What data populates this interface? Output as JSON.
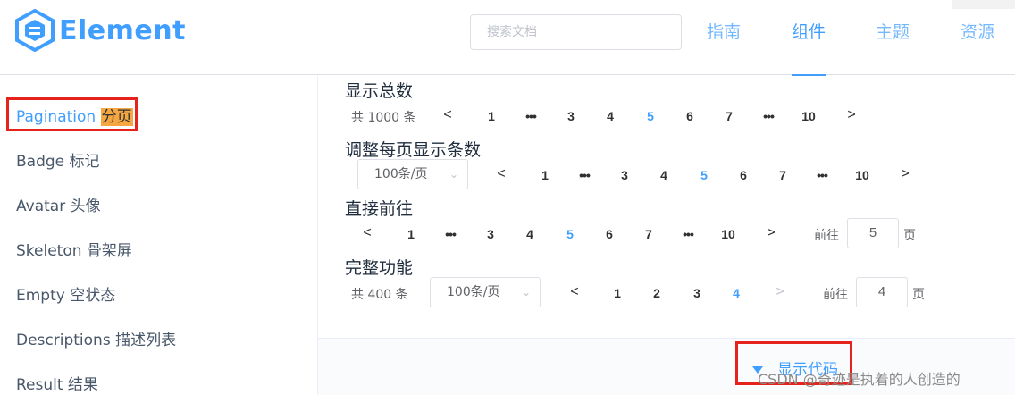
{
  "header": {
    "logo_text": "Element",
    "search_placeholder": "搜索文档",
    "nav": [
      "指南",
      "组件",
      "主题",
      "资源"
    ]
  },
  "sidebar": {
    "items": [
      {
        "label": "Pagination",
        "highlight": "分页"
      },
      {
        "label": "Badge 标记"
      },
      {
        "label": "Avatar 头像"
      },
      {
        "label": "Skeleton 骨架屏"
      },
      {
        "label": "Empty 空状态"
      },
      {
        "label": "Descriptions 描述列表"
      },
      {
        "label": "Result 结果"
      }
    ]
  },
  "main": {
    "s1": {
      "title": "显示总数",
      "total": "共 1000 条",
      "pages": [
        "1",
        "•••",
        "3",
        "4",
        "5",
        "6",
        "7",
        "•••",
        "10"
      ]
    },
    "s2": {
      "title": "调整每页显示条数",
      "size": "100条/页",
      "pages": [
        "1",
        "•••",
        "3",
        "4",
        "5",
        "6",
        "7",
        "•••",
        "10"
      ]
    },
    "s3": {
      "title": "直接前往",
      "pages": [
        "1",
        "•••",
        "3",
        "4",
        "5",
        "6",
        "7",
        "•••",
        "10"
      ],
      "goto_label": "前往",
      "goto_value": "5",
      "page_unit": "页"
    },
    "s4": {
      "title": "完整功能",
      "total": "共 400 条",
      "size": "100条/页",
      "pages": [
        "1",
        "2",
        "3",
        "4"
      ],
      "goto_label": "前往",
      "goto_value": "4",
      "page_unit": "页"
    },
    "show_code": "显示代码"
  },
  "watermark": "CSDN @奇迹是执着的人创造的",
  "colors": {
    "accent": "#409eff",
    "highlight": "#f5a742",
    "annotation": "#e5231c"
  }
}
